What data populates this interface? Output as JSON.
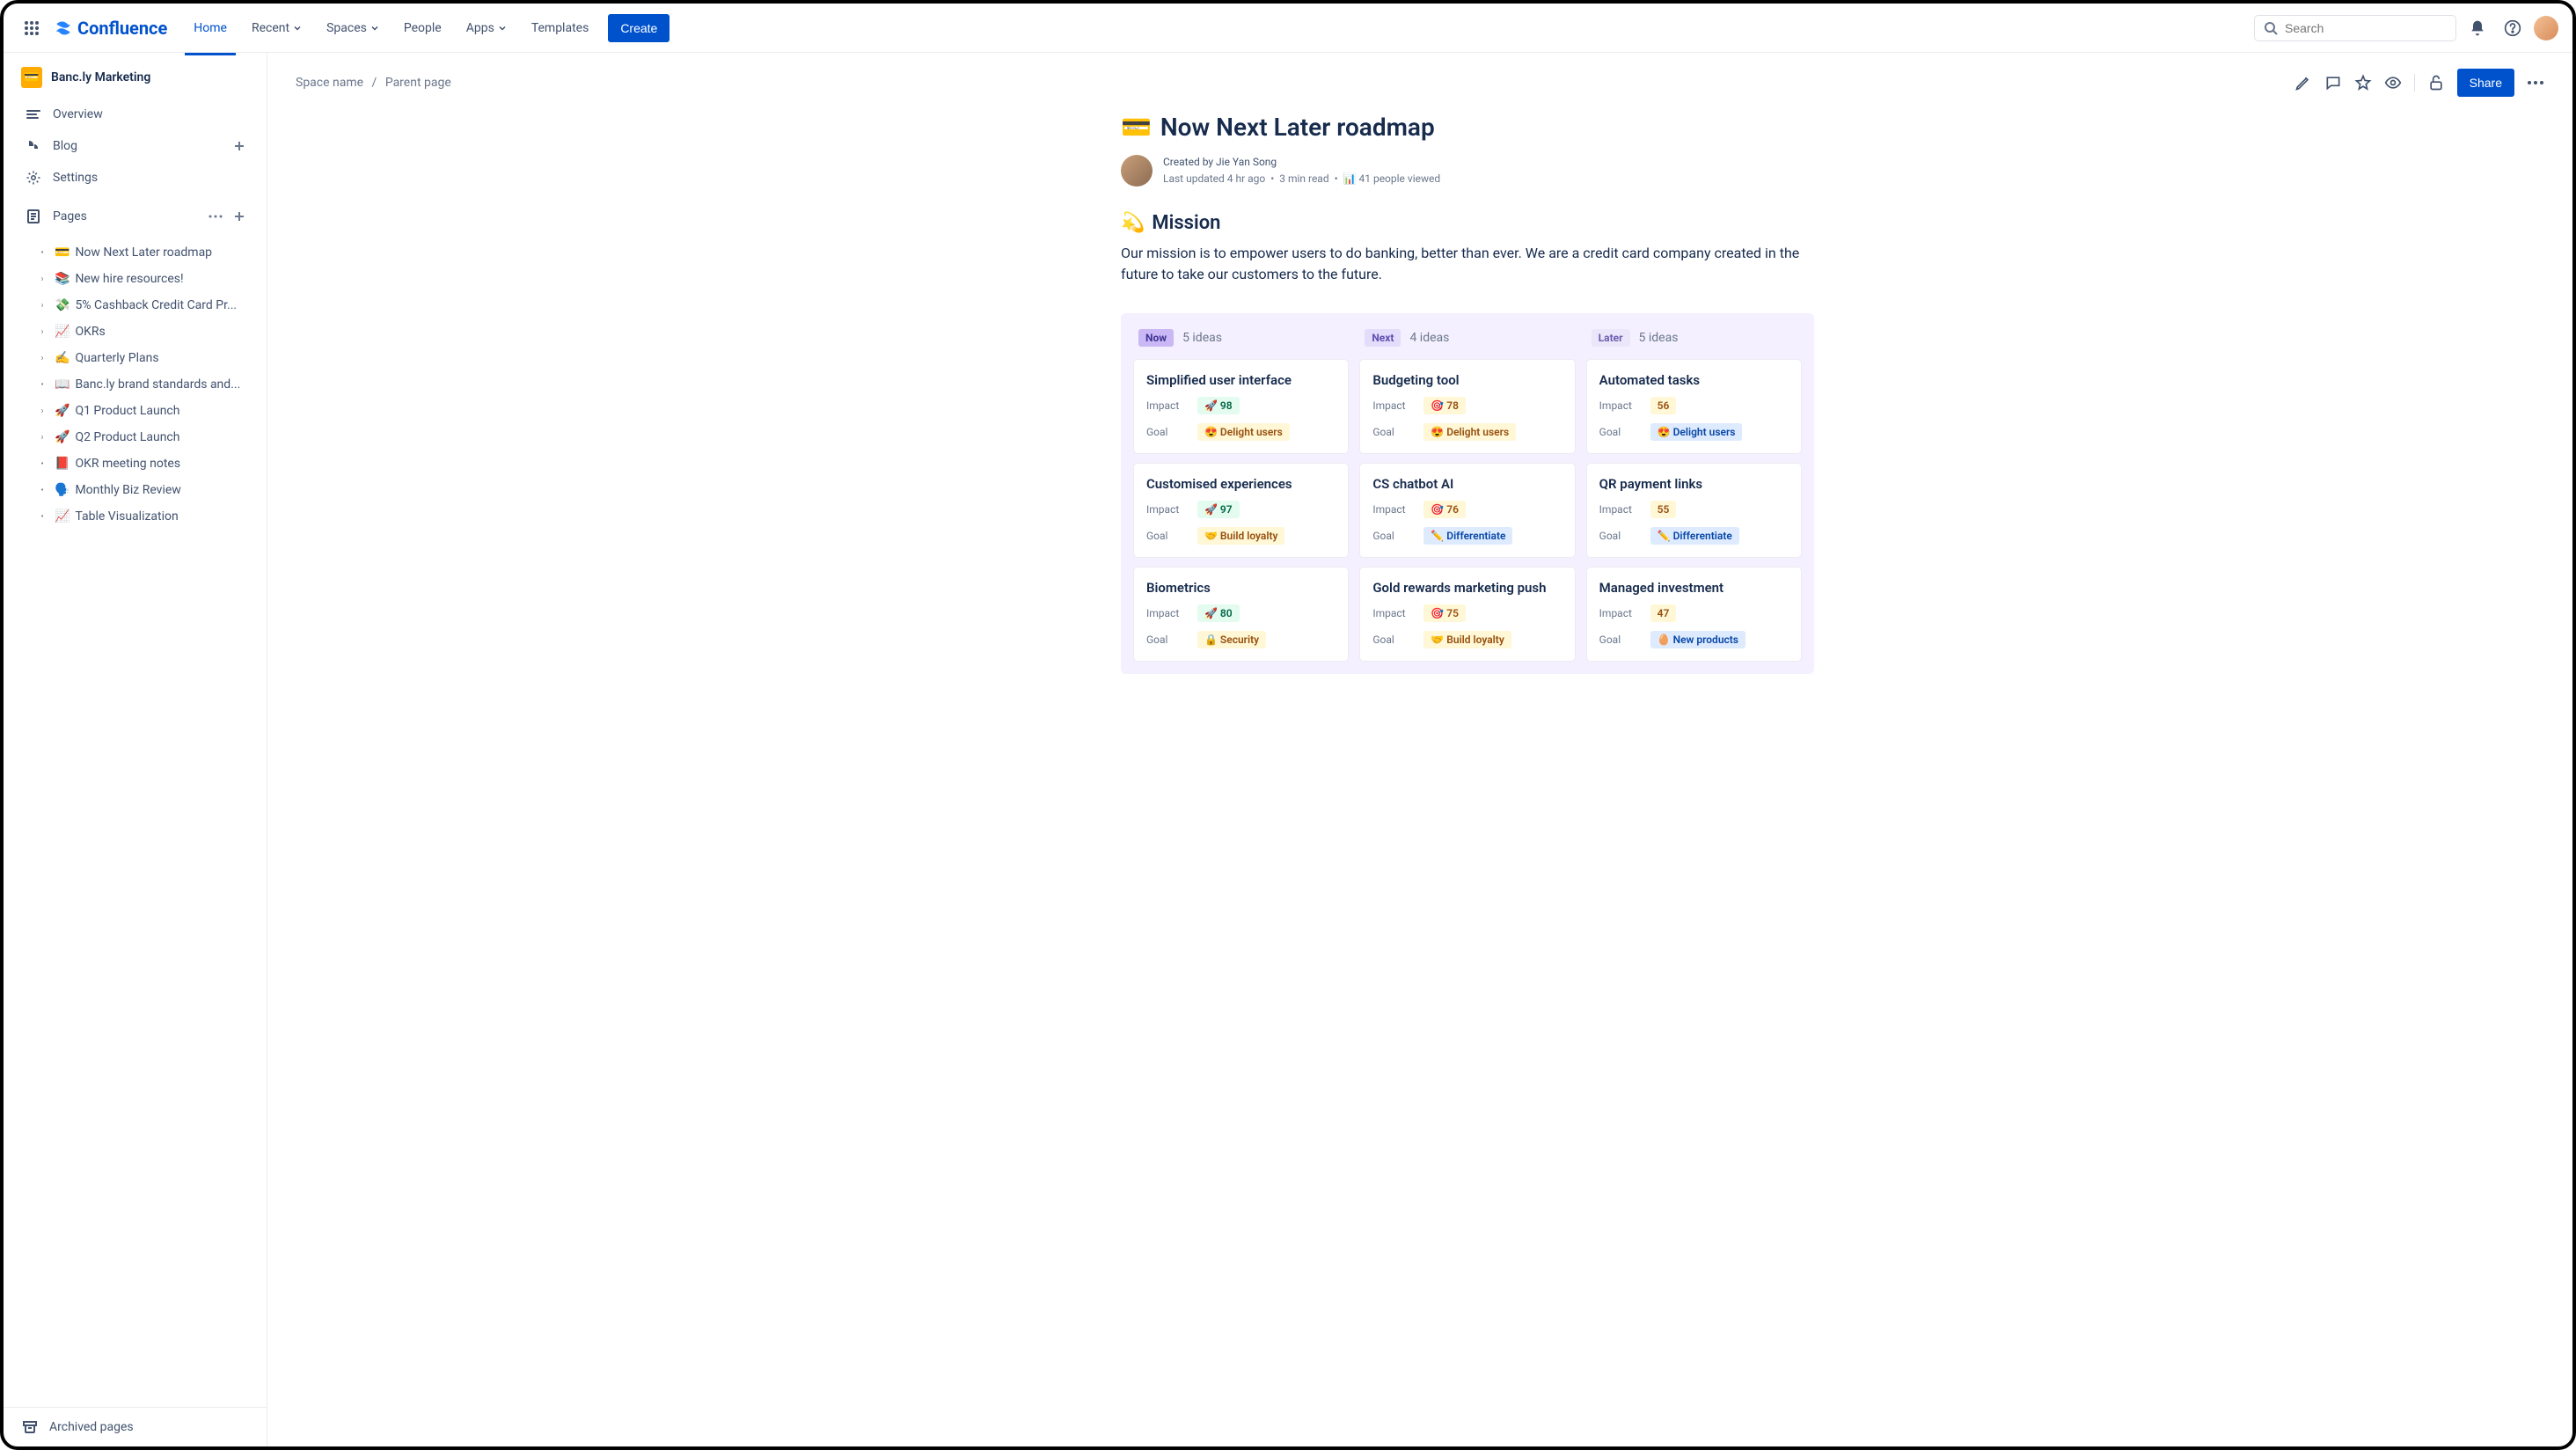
{
  "brand": "Confluence",
  "nav": {
    "home": "Home",
    "recent": "Recent",
    "spaces": "Spaces",
    "people": "People",
    "apps": "Apps",
    "templates": "Templates",
    "create": "Create"
  },
  "search": {
    "placeholder": "Search"
  },
  "sidebar": {
    "space": {
      "emoji": "💳",
      "name": "Banc.ly Marketing"
    },
    "overview": "Overview",
    "blog": "Blog",
    "settings": "Settings",
    "pages_label": "Pages",
    "pages": [
      {
        "bullet": "•",
        "emoji": "💳",
        "label": "Now Next Later roadmap"
      },
      {
        "bullet": "›",
        "emoji": "📚",
        "label": "New hire resources!"
      },
      {
        "bullet": "›",
        "emoji": "💸",
        "label": "5% Cashback Credit Card Pr..."
      },
      {
        "bullet": "›",
        "emoji": "📈",
        "label": "OKRs"
      },
      {
        "bullet": "›",
        "emoji": "✍️",
        "label": "Quarterly Plans"
      },
      {
        "bullet": "•",
        "emoji": "📖",
        "label": "Banc.ly brand standards and..."
      },
      {
        "bullet": "›",
        "emoji": "🚀",
        "label": "Q1 Product Launch"
      },
      {
        "bullet": "›",
        "emoji": "🚀",
        "label": "Q2 Product Launch"
      },
      {
        "bullet": "•",
        "emoji": "📕",
        "label": "OKR meeting notes"
      },
      {
        "bullet": "•",
        "emoji": "🗣️",
        "label": "Monthly Biz Review"
      },
      {
        "bullet": "•",
        "emoji": "📈",
        "label": "Table Visualization"
      }
    ],
    "archived": "Archived pages"
  },
  "breadcrumb": {
    "space": "Space name",
    "parent": "Parent page"
  },
  "actions": {
    "share": "Share"
  },
  "page": {
    "emoji": "💳",
    "title": "Now Next Later roadmap",
    "created_by_prefix": "Created by ",
    "author": "Jie Yan Song",
    "updated": "Last updated  4 hr ago",
    "read": "3 min read",
    "viewed": "41 people viewed",
    "mission_emoji": "💫",
    "mission_title": "Mission",
    "mission_text": "Our mission is to empower users to do banking, better than ever. We are a credit card company created in the future to take our customers to the future."
  },
  "board": {
    "columns": [
      {
        "key": "now",
        "badge": "Now",
        "count": "5 ideas",
        "cards": [
          {
            "title": "Simplified user interface",
            "impact_emoji": "🚀",
            "impact": "98",
            "impact_style": "green",
            "goal_emoji": "😍",
            "goal": "Delight users",
            "goal_style": "yellow"
          },
          {
            "title": "Customised experiences",
            "impact_emoji": "🚀",
            "impact": "97",
            "impact_style": "green",
            "goal_emoji": "🤝",
            "goal": "Build loyalty",
            "goal_style": "yellow"
          },
          {
            "title": "Biometrics",
            "impact_emoji": "🚀",
            "impact": "80",
            "impact_style": "green",
            "goal_emoji": "🔒",
            "goal": "Security",
            "goal_style": "yellow"
          }
        ]
      },
      {
        "key": "next",
        "badge": "Next",
        "count": "4 ideas",
        "cards": [
          {
            "title": "Budgeting tool",
            "impact_emoji": "🎯",
            "impact": "78",
            "impact_style": "yellow",
            "goal_emoji": "😍",
            "goal": "Delight users",
            "goal_style": "yellow"
          },
          {
            "title": "CS chatbot AI",
            "impact_emoji": "🎯",
            "impact": "76",
            "impact_style": "yellow",
            "goal_emoji": "✏️",
            "goal": "Differentiate",
            "goal_style": "blue"
          },
          {
            "title": "Gold rewards marketing push",
            "impact_emoji": "🎯",
            "impact": "75",
            "impact_style": "yellow",
            "goal_emoji": "🤝",
            "goal": "Build loyalty",
            "goal_style": "yellow"
          }
        ]
      },
      {
        "key": "later",
        "badge": "Later",
        "count": "5 ideas",
        "cards": [
          {
            "title": "Automated tasks",
            "impact_emoji": "",
            "impact": "56",
            "impact_style": "yellow",
            "goal_emoji": "😍",
            "goal": "Delight users",
            "goal_style": "blue"
          },
          {
            "title": "QR payment links",
            "impact_emoji": "",
            "impact": "55",
            "impact_style": "yellow",
            "goal_emoji": "✏️",
            "goal": "Differentiate",
            "goal_style": "blue"
          },
          {
            "title": "Managed investment",
            "impact_emoji": "",
            "impact": "47",
            "impact_style": "yellow",
            "goal_emoji": "🥚",
            "goal": "New products",
            "goal_style": "blue"
          }
        ]
      }
    ],
    "labels": {
      "impact": "Impact",
      "goal": "Goal"
    }
  }
}
